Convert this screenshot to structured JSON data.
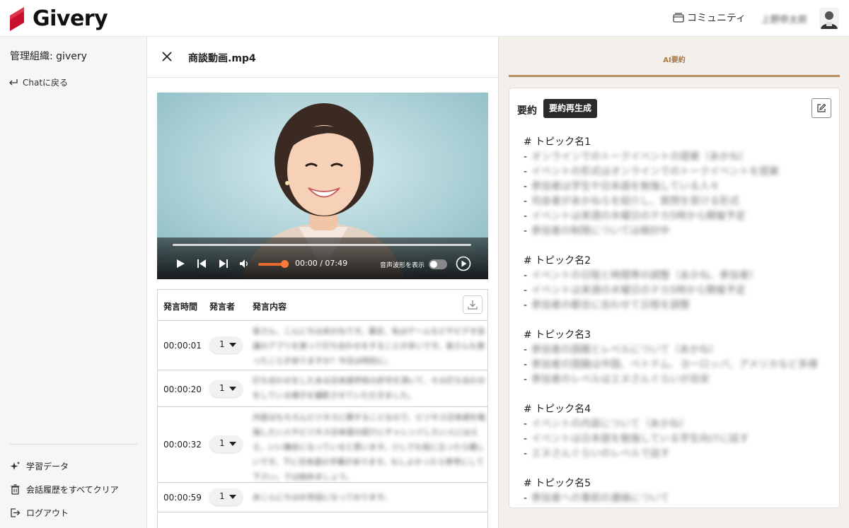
{
  "header": {
    "logo_text": "Givery",
    "community_label": "コミュニティ",
    "user_name": "上野恭太郎"
  },
  "sidebar": {
    "org_label": "管理組織: givery",
    "back_label": "Chatに戻る",
    "items": [
      {
        "label": "学習データ",
        "icon": "sparkle-icon"
      },
      {
        "label": "会話履歴をすべてクリア",
        "icon": "trash-icon"
      },
      {
        "label": "ログアウト",
        "icon": "logout-icon"
      }
    ]
  },
  "player": {
    "file_name": "商談動画.mp4",
    "time": "00:00 / 07:49",
    "waveform_label": "音声波形を表示",
    "waveform_enabled": false,
    "volume": 1.0
  },
  "transcript": {
    "headers": [
      "発言時間",
      "発言者",
      "発言内容"
    ],
    "rows": [
      {
        "time": "00:00:01",
        "speaker": "1",
        "text": "皆さん、こんにちはあかねです。最近、私はゲームなどやビデオ会議のアプリを使って打ち合わせをすることが多いです。皆さんも使ったことがありますか？今日は特別に。"
      },
      {
        "time": "00:00:20",
        "speaker": "1",
        "text": "打ち合わせをしたある日本語学校の許可を頂いて、その打ち合わせをしている様子を撮影させていただきました。"
      },
      {
        "time": "00:00:32",
        "speaker": "1",
        "text": "内容はもちろんビジネスに関することなので、ビジネス日本語を勉強したい人やビジネス日本語の紹介にチャレンジしたい人にはええ、いい機会になっていると思います。少しでも役に立ったら嬉しいです。下に日本語の字幕があります。もしよかったら参考にして下さい。では始めましょう。"
      },
      {
        "time": "00:00:59",
        "speaker": "1",
        "text": "あこんにちはお世話になっております。"
      }
    ]
  },
  "summary": {
    "tab_label": "AI要約",
    "title": "要約",
    "regenerate_label": "要約再生成",
    "topics": [
      {
        "name": "# トピック名1",
        "bullets": [
          "オンラインでのトークイベントの提案（あかね）",
          "イベントの形式はオンラインでのトークイベントを提案",
          "参加者は学生や日本語を勉強している人々",
          "司会者があかねらを紹介し、質問を受ける形式",
          "イベントは来週の木曜日のテカ5時から開催予定",
          "参加者の制限については検討中"
        ]
      },
      {
        "name": "# トピック名2",
        "bullets": [
          "イベントの日程と時間帯の調整（あかね、参加者）",
          "イベントは来週の木曜日のテカ5時から開催予定",
          "参加者の都合に合わせて日程を調整"
        ]
      },
      {
        "name": "# トピック名3",
        "bullets": [
          "参加者の国籍とレベルについて（あかね）",
          "参加者の国籍は中国、ベトナム、ヨーロッパ、アメリカなど多様",
          "参加者のレベルはエヌさんぐらいが目安"
        ]
      },
      {
        "name": "# トピック名4",
        "bullets": [
          "イベントの内容について（あかね）",
          "イベントは日本語を勉強している学生向けに話す",
          "エヌさんぐらいのレベルで話す"
        ]
      },
      {
        "name": "# トピック名5",
        "bullets": [
          "参加者への事前の連絡について"
        ]
      }
    ]
  },
  "colors": {
    "accent_brown": "#b98f63",
    "volume_orange": "#e8672a",
    "logo_red": "#c8102e"
  }
}
